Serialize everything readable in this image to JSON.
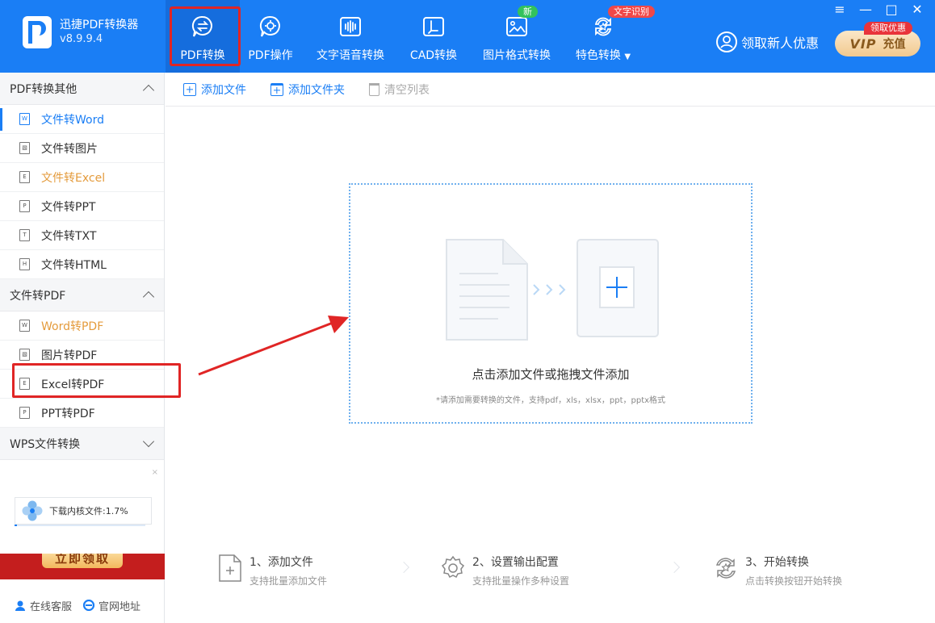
{
  "app": {
    "name": "迅捷PDF转换器",
    "version": "v8.9.9.4"
  },
  "nav": [
    {
      "label": "PDF转换",
      "icon": "pdf-convert-icon",
      "badge": ""
    },
    {
      "label": "PDF操作",
      "icon": "pdf-operation-icon",
      "badge": ""
    },
    {
      "label": "文字语音转换",
      "icon": "voice-wave-icon",
      "badge": ""
    },
    {
      "label": "CAD转换",
      "icon": "cad-icon",
      "badge": ""
    },
    {
      "label": "图片格式转换",
      "icon": "image-icon",
      "badge": "新"
    },
    {
      "label": "特色转换",
      "icon": "refresh-star-icon",
      "badge": "文字识别"
    }
  ],
  "promo": {
    "label": "领取新人优惠"
  },
  "vip": {
    "word": "VIP",
    "label": "充值",
    "tag": "领取优惠"
  },
  "window": {
    "minimize": "—",
    "maximize": "□",
    "close": "✕"
  },
  "sidebar": {
    "section1": {
      "title": "PDF转换其他",
      "items": [
        {
          "label": "文件转Word",
          "icon": "W"
        },
        {
          "label": "文件转图片",
          "icon": "▧"
        },
        {
          "label": "文件转Excel",
          "icon": "E"
        },
        {
          "label": "文件转PPT",
          "icon": "P"
        },
        {
          "label": "文件转TXT",
          "icon": "T"
        },
        {
          "label": "文件转HTML",
          "icon": "H"
        }
      ]
    },
    "section2": {
      "title": "文件转PDF",
      "items": [
        {
          "label": "Word转PDF",
          "icon": "W"
        },
        {
          "label": "图片转PDF",
          "icon": "▧"
        },
        {
          "label": "Excel转PDF",
          "icon": "E"
        },
        {
          "label": "PPT转PDF",
          "icon": "P"
        }
      ]
    },
    "section3": {
      "title": "WPS文件转换"
    },
    "ad": {
      "close": "×",
      "download_text": "下载内核文件:1.7%",
      "download_progress": 0.017,
      "banner_button": "立即领取"
    },
    "footer": {
      "service": "在线客服",
      "website": "官网地址"
    }
  },
  "toolbar": {
    "add_file": "添加文件",
    "add_folder": "添加文件夹",
    "clear_list": "清空列表"
  },
  "dropzone": {
    "title": "点击添加文件或拖拽文件添加",
    "hint": "*请添加需要转换的文件，支持pdf，xls，xlsx，ppt，pptx格式"
  },
  "steps": [
    {
      "title": "1、添加文件",
      "subtitle": "支持批量添加文件"
    },
    {
      "title": "2、设置输出配置",
      "subtitle": "支持批量操作多种设置"
    },
    {
      "title": "3、开始转换",
      "subtitle": "点击转换按钮开始转换"
    }
  ],
  "colors": {
    "brand": "#1a7ef5",
    "highlight": "#e02525",
    "orange_text": "#e49b3c"
  }
}
